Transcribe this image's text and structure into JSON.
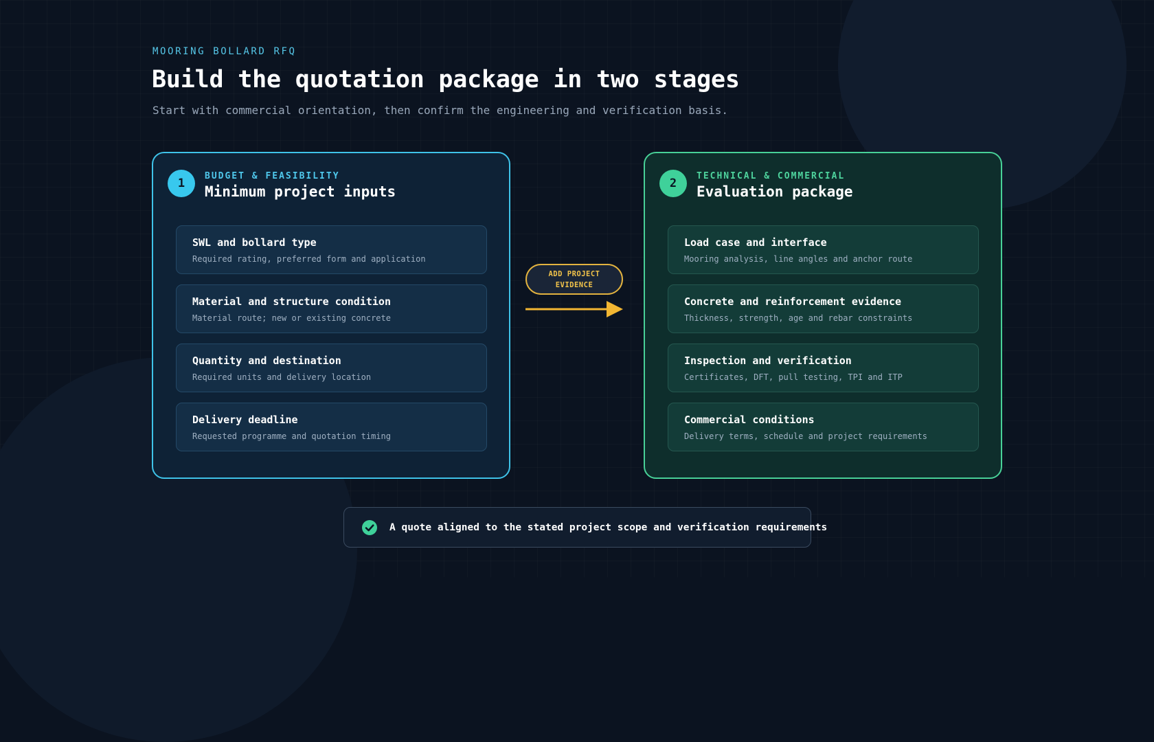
{
  "header": {
    "eyebrow": "MOORING BOLLARD RFQ",
    "title": "Build the quotation package in two stages",
    "subtitle": "Start with commercial orientation, then confirm the engineering and verification basis."
  },
  "stages": [
    {
      "number": "1",
      "label": "BUDGET & FEASIBILITY",
      "title": "Minimum project inputs",
      "accent_color": "#38c8ee",
      "items": [
        {
          "title": "SWL and bollard type",
          "desc": "Required rating, preferred form and application"
        },
        {
          "title": "Material and structure condition",
          "desc": "Material route; new or existing concrete"
        },
        {
          "title": "Quantity and destination",
          "desc": "Required units and delivery location"
        },
        {
          "title": "Delivery deadline",
          "desc": "Requested programme and quotation timing"
        }
      ]
    },
    {
      "number": "2",
      "label": "TECHNICAL & COMMERCIAL",
      "title": "Evaluation package",
      "accent_color": "#3fd19a",
      "items": [
        {
          "title": "Load case and interface",
          "desc": "Mooring analysis, line angles and anchor route"
        },
        {
          "title": "Concrete and reinforcement evidence",
          "desc": "Thickness, strength, age and rebar constraints"
        },
        {
          "title": "Inspection and verification",
          "desc": "Certificates, DFT, pull testing, TPI and ITP"
        },
        {
          "title": "Commercial conditions",
          "desc": "Delivery terms, schedule and project requirements"
        }
      ]
    }
  ],
  "connector": {
    "label": "ADD PROJECT EVIDENCE",
    "color": "#f2c34a",
    "icon": "arrow-right-icon"
  },
  "outcome": {
    "icon": "check-circle-icon",
    "text": "A quote aligned to the stated project scope and verification requirements"
  }
}
